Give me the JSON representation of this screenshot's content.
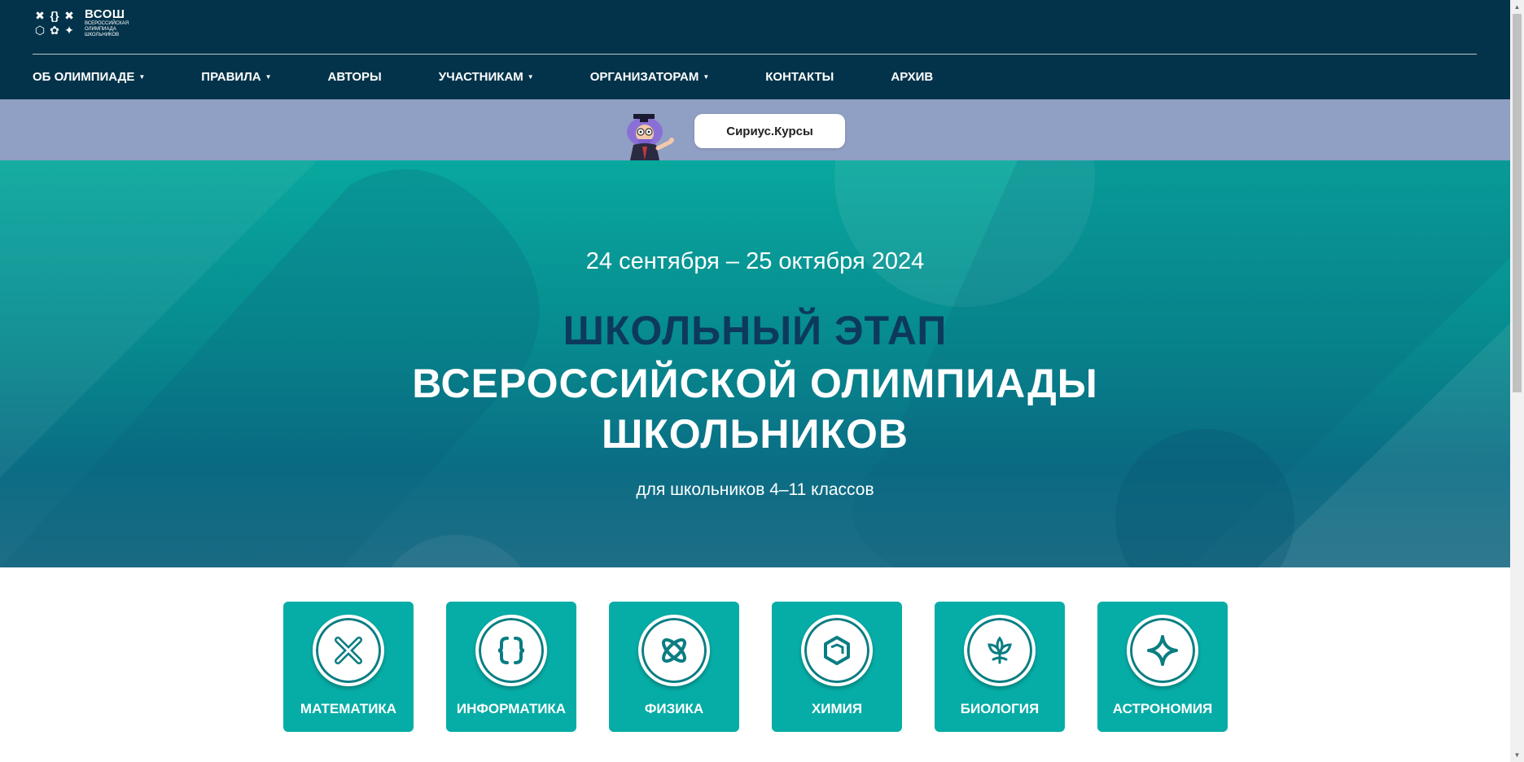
{
  "logo": {
    "title": "ВСОШ",
    "subtitle_lines": [
      "ВСЕРОССИЙСКАЯ",
      "ОЛИМПИАДА",
      "ШКОЛЬНИКОВ"
    ]
  },
  "nav": {
    "items": [
      {
        "label": "ОБ ОЛИМПИАДЕ",
        "dropdown": true
      },
      {
        "label": "ПРАВИЛА",
        "dropdown": true
      },
      {
        "label": "АВТОРЫ",
        "dropdown": false
      },
      {
        "label": "УЧАСТНИКАМ",
        "dropdown": true
      },
      {
        "label": "ОРГАНИЗАТОРАМ",
        "dropdown": true
      },
      {
        "label": "КОНТАКТЫ",
        "dropdown": false
      },
      {
        "label": "АРХИВ",
        "dropdown": false
      }
    ]
  },
  "promo": {
    "button_label": "Сириус.Курсы"
  },
  "hero": {
    "date": "24 сентября – 25 октября 2024",
    "title_line1": "ШКОЛЬНЫЙ ЭТАП",
    "title_line2": "ВСЕРОССИЙСКОЙ ОЛИМПИАДЫ",
    "title_line3": "ШКОЛЬНИКОВ",
    "subtitle": "для школьников 4–11 классов"
  },
  "subjects": [
    {
      "label": "МАТЕМАТИКА",
      "icon": "math-icon"
    },
    {
      "label": "ИНФОРМАТИКА",
      "icon": "informatics-icon"
    },
    {
      "label": "ФИЗИКА",
      "icon": "physics-icon"
    },
    {
      "label": "ХИМИЯ",
      "icon": "chemistry-icon"
    },
    {
      "label": "БИОЛОГИЯ",
      "icon": "biology-icon"
    },
    {
      "label": "АСТРОНОМИЯ",
      "icon": "astronomy-icon"
    }
  ],
  "colors": {
    "header_bg": "#03334a",
    "promo_bg": "#909fc4",
    "accent_teal": "#06ada6",
    "title_dark": "#0d3a5c"
  }
}
